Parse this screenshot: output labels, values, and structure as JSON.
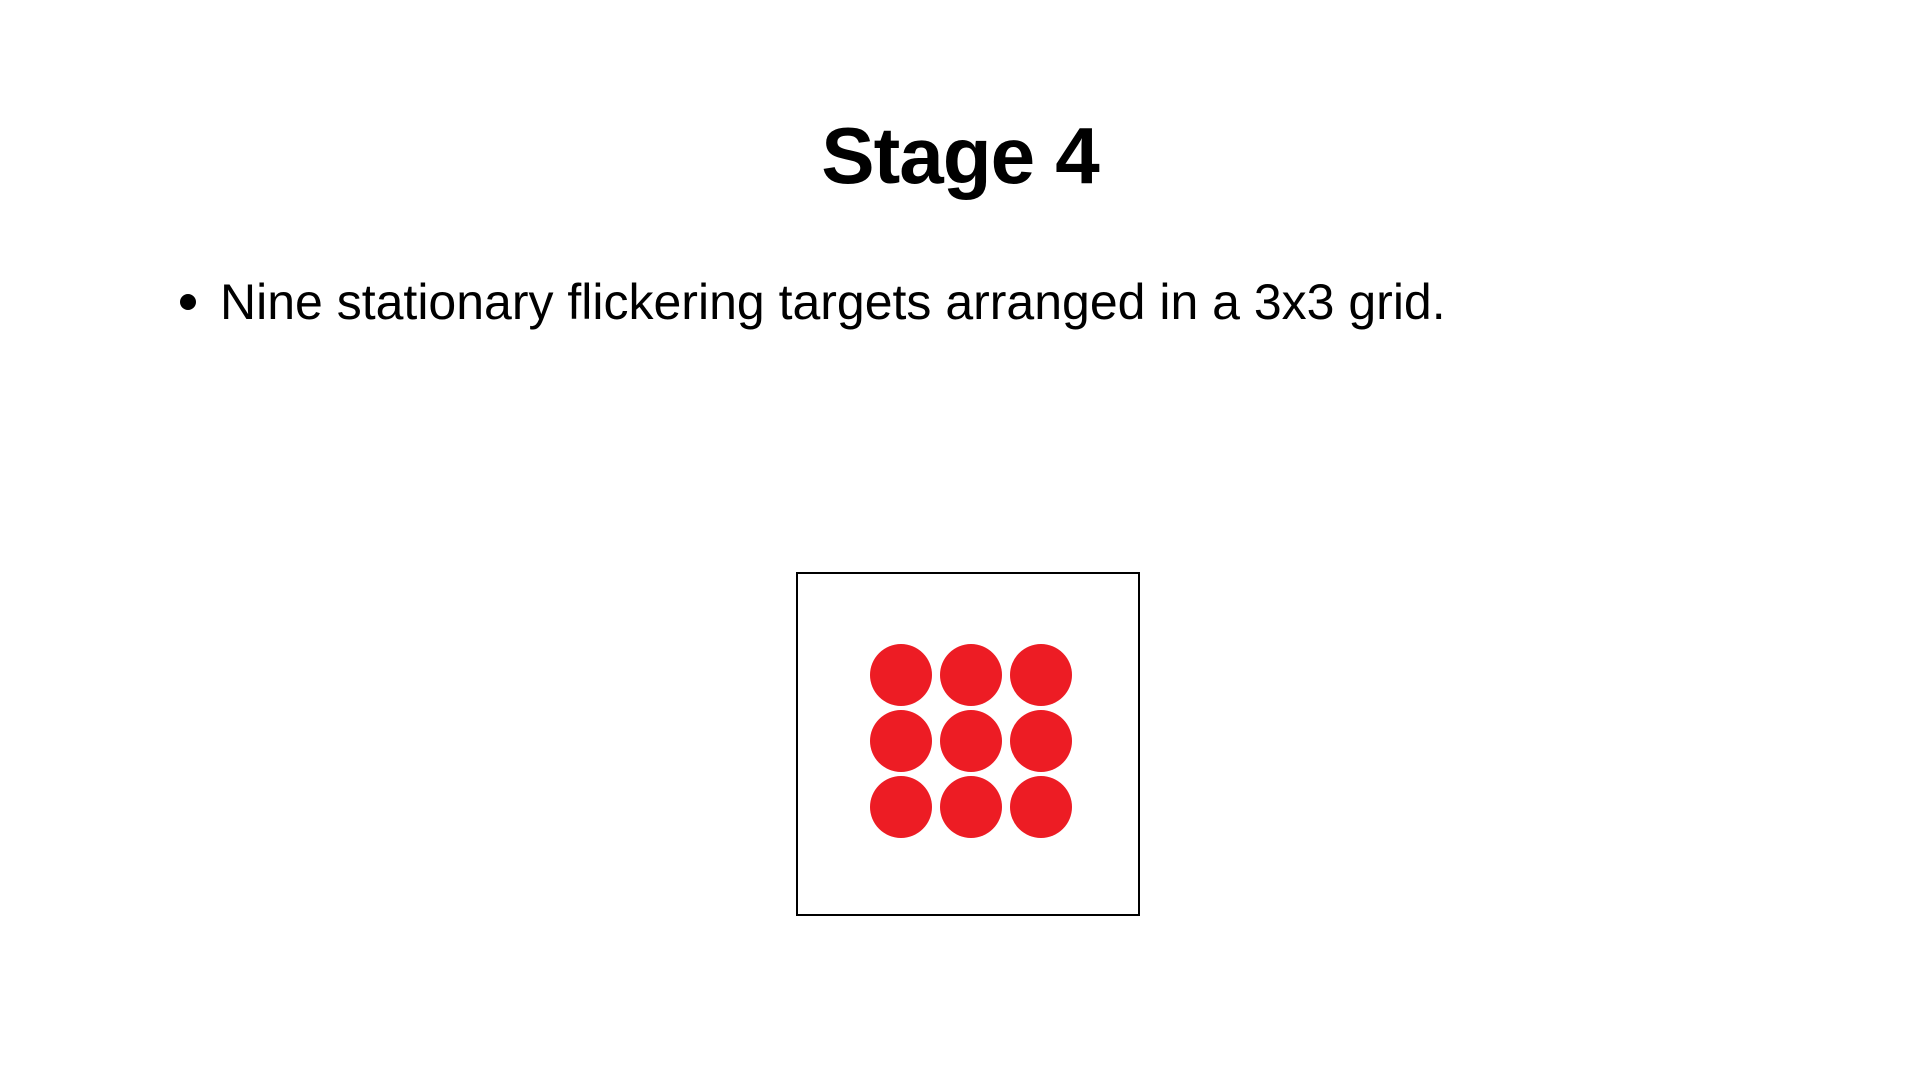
{
  "slide": {
    "title": "Stage 4",
    "bullets": [
      {
        "text": "Nine stationary flickering targets arranged in a 3x3 grid."
      }
    ]
  },
  "figure": {
    "grid_rows": 3,
    "grid_cols": 3,
    "target_count": 9,
    "target_color": "#ED1C24",
    "frame_color": "#000000"
  }
}
